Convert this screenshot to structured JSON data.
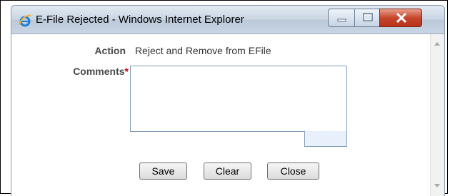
{
  "window": {
    "title": "E-File Rejected - Windows Internet Explorer"
  },
  "form": {
    "action_label": "Action",
    "action_value": "Reject and Remove from EFile",
    "comments_label": "Comments",
    "required_marker": "*",
    "comments_value": ""
  },
  "buttons": {
    "save": "Save",
    "clear": "Clear",
    "close": "Close"
  },
  "colors": {
    "required": "#cc0000",
    "close_button": "#c6462b"
  }
}
